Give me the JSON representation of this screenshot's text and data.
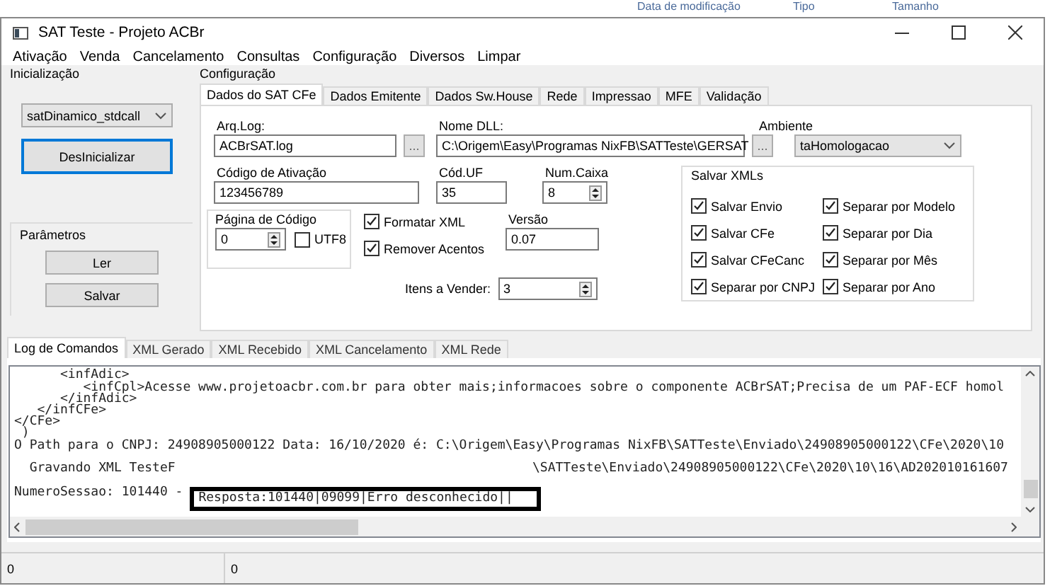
{
  "background_window": {
    "columns": [
      "Data de modificação",
      "Tipo",
      "Tamanho"
    ]
  },
  "window": {
    "title": "SAT Teste - Projeto ACBr"
  },
  "menu": [
    "Ativação",
    "Venda",
    "Cancelamento",
    "Consultas",
    "Configuração",
    "Diversos",
    "Limpar"
  ],
  "inicializacao": {
    "title": "Inicialização",
    "model": "satDinamico_stdcall",
    "button": "DesInicializar"
  },
  "parametros": {
    "title": "Parâmetros",
    "buttons": [
      "Ler",
      "Salvar"
    ]
  },
  "configuracao": {
    "title": "Configuração",
    "tabs": [
      {
        "label": "Dados do SAT CFe",
        "selected": true
      },
      {
        "label": "Dados Emitente",
        "selected": false
      },
      {
        "label": "Dados Sw.House",
        "selected": false
      },
      {
        "label": "Rede",
        "selected": false
      },
      {
        "label": "Impressao",
        "selected": false
      },
      {
        "label": "MFE",
        "selected": false
      },
      {
        "label": "Validação",
        "selected": false
      }
    ],
    "arq_log": {
      "label": "Arq.Log:",
      "value": "ACBrSAT.log",
      "browse": "..."
    },
    "nome_dll": {
      "label": "Nome DLL:",
      "value": "C:\\Origem\\Easy\\Programas NixFB\\SATTeste\\GERSAT",
      "browse": "..."
    },
    "ambiente": {
      "label": "Ambiente",
      "value": "taHomologacao"
    },
    "codigo_ativacao": {
      "label": "Código de Ativação",
      "value": "123456789"
    },
    "cod_uf": {
      "label": "Cód.UF",
      "value": "35"
    },
    "num_caixa": {
      "label": "Num.Caixa",
      "value": "8"
    },
    "pagina_codigo": {
      "title": "Página de Código",
      "value": "0",
      "utf8": {
        "label": "UTF8",
        "checked": false
      }
    },
    "options": [
      {
        "label": "Formatar XML",
        "checked": true
      },
      {
        "label": "Remover Acentos",
        "checked": true
      }
    ],
    "versao": {
      "label": "Versão",
      "value": "0.07"
    },
    "itens_vender": {
      "label": "Itens a Vender:",
      "value": "3"
    },
    "salvar_xmls": {
      "title": "Salvar XMLs",
      "options": [
        {
          "label": "Salvar Envio",
          "checked": true
        },
        {
          "label": "Separar por Modelo",
          "checked": true
        },
        {
          "label": "Salvar CFe",
          "checked": true
        },
        {
          "label": "Separar por Dia",
          "checked": true
        },
        {
          "label": "Salvar CFeCanc",
          "checked": true
        },
        {
          "label": "Separar por Mês",
          "checked": true
        },
        {
          "label": "Separar por CNPJ",
          "checked": true
        },
        {
          "label": "Separar por Ano",
          "checked": true
        }
      ]
    }
  },
  "log_tabs": [
    {
      "label": "Log de Comandos",
      "selected": true
    },
    {
      "label": "XML Gerado",
      "selected": false
    },
    {
      "label": "XML Recebido",
      "selected": false
    },
    {
      "label": "XML Cancelamento",
      "selected": false
    },
    {
      "label": "XML Rede",
      "selected": false
    }
  ],
  "log": {
    "lines": [
      "      <infAdic>",
      "         <infCpl>Acesse www.projetoacbr.com.br para obter mais;informacoes sobre o componente ACBrSAT;Precisa de um PAF-ECF homol",
      "      </infAdic>",
      "   </infCFe>",
      "</CFe>",
      " )",
      "O Path para o CNPJ: 24908905000122 Data: 16/10/2020 é: C:\\Origem\\Easy\\Programas NixFB\\SATTeste\\Enviado\\24908905000122\\CFe\\2020\\10"
    ],
    "gravando": [
      "  Gravando XML TesteF",
      "\\SATTeste\\Enviado\\24908905000122\\CFe\\2020\\10\\16\\AD202010161607"
    ],
    "sessao": "NumeroSessao: 101440 -",
    "resposta": "Resposta:101440|09099|Erro desconhecido||"
  },
  "status_bar": [
    "0",
    "0"
  ]
}
